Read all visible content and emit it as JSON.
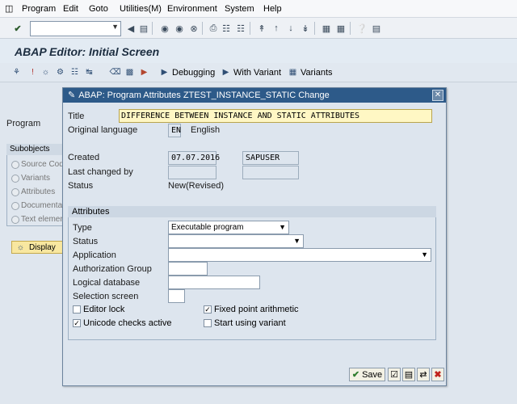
{
  "menu": [
    "Program",
    "Edit",
    "Goto",
    "Utilities(M)",
    "Environment",
    "System",
    "Help"
  ],
  "screen_title": "ABAP Editor: Initial Screen",
  "app_toolbar": {
    "debugging": "Debugging",
    "with_variant": "With Variant",
    "variants": "Variants"
  },
  "background": {
    "program_label": "Program",
    "subobjects_title": "Subobjects",
    "subobjects": [
      "Source Code",
      "Variants",
      "Attributes",
      "Documentation",
      "Text elements"
    ],
    "display_button": "Display"
  },
  "dialog": {
    "title": "ABAP: Program Attributes ZTEST_INSTANCE_STATIC Change",
    "title_label": "Title",
    "title_value": "DIFFERENCE BETWEEN INSTANCE AND STATIC ATTRIBUTES",
    "original_language_label": "Original language",
    "language_code": "EN",
    "language_name": "English",
    "created_label": "Created",
    "created_date": "07.07.2016",
    "created_user": "SAPUSER",
    "last_changed_label": "Last changed by",
    "status_label": "Status",
    "status_value": "New(Revised)",
    "attributes_title": "Attributes",
    "type_label": "Type",
    "type_value": "Executable program",
    "status2_label": "Status",
    "application_label": "Application",
    "auth_group_label": "Authorization Group",
    "logical_db_label": "Logical database",
    "selection_screen_label": "Selection screen",
    "editor_lock_label": "Editor lock",
    "fixed_point_label": "Fixed point arithmetic",
    "unicode_label": "Unicode checks active",
    "start_variant_label": "Start using variant",
    "editor_lock": false,
    "fixed_point": true,
    "unicode": true,
    "start_variant": false,
    "save_label": "Save"
  }
}
